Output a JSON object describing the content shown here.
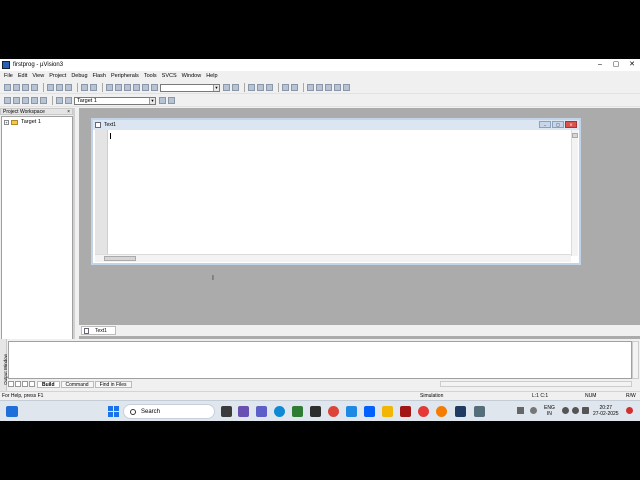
{
  "app": {
    "title": "firstprog - µVision3",
    "window_controls": [
      "–",
      "▢",
      "✕"
    ]
  },
  "menu": [
    "File",
    "Edit",
    "View",
    "Project",
    "Debug",
    "Flash",
    "Peripherals",
    "Tools",
    "SVCS",
    "Window",
    "Help"
  ],
  "toolbar": {
    "find_combo_value": "",
    "target_combo_value": "Target 1"
  },
  "workspace": {
    "header": "Project Workspace",
    "close": "×",
    "tree": [
      {
        "label": "Target 1",
        "expander": "+"
      }
    ]
  },
  "editor": {
    "window_title": "Text1",
    "content": ""
  },
  "doc_tabs": [
    {
      "label": "Text1"
    }
  ],
  "output": {
    "side_label": "Output Window",
    "tabs": [
      "Build",
      "Command",
      "Find in Files"
    ],
    "active_tab": "Build"
  },
  "status": {
    "help": "For Help, press F1",
    "mode": "Simulation",
    "position": "L:1 C:1",
    "num": "NUM",
    "rw": "R/W"
  },
  "taskbar": {
    "search_placeholder": "Search",
    "lang": "ENG",
    "region": "IN",
    "time": "20:27",
    "date": "27-02-2025"
  },
  "colors": {
    "accent": "#1a73e8",
    "mdi_background": "#ababab",
    "window_title": "#dce6f3"
  }
}
